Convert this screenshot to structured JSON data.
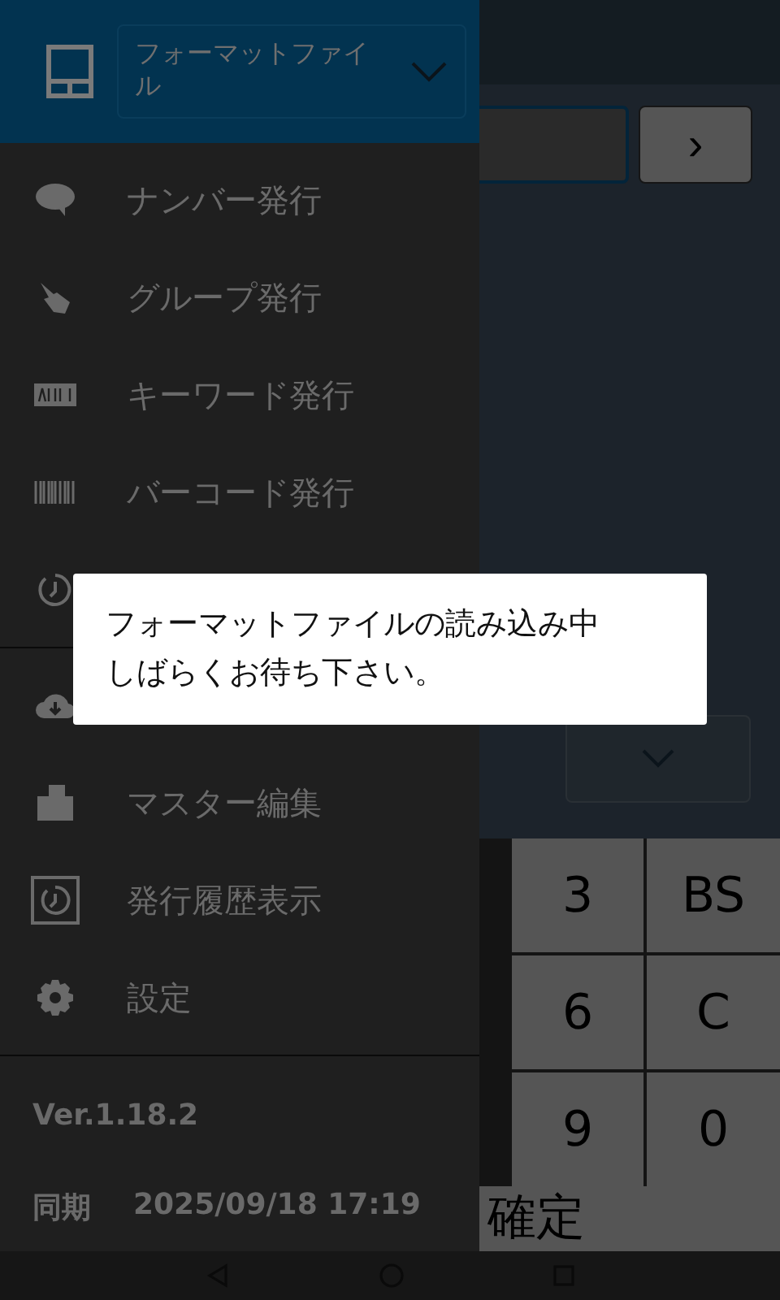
{
  "app": {
    "next_button": "›",
    "keys": [
      "3",
      "BS",
      "6",
      "C",
      "9",
      "0"
    ],
    "confirm_button": "確定"
  },
  "drawer": {
    "format_select": {
      "value": "フォーマットファイル"
    },
    "sections": [
      {
        "items": [
          {
            "label": "ナンバー発行"
          },
          {
            "label": "グループ発行"
          },
          {
            "label": "キーワード発行"
          },
          {
            "label": "バーコード発行"
          }
        ]
      },
      {
        "items": [
          {
            "label": "マスター編集"
          },
          {
            "label": "発行履歴表示"
          },
          {
            "label": "設定"
          }
        ]
      }
    ],
    "version": "Ver.1.18.2",
    "sync_label": "同期",
    "sync_time": "2025/09/18 17:19"
  },
  "dialog": {
    "lines": [
      "フォーマットファイルの読み込み中",
      "しばらくお待ち下さい。"
    ]
  }
}
